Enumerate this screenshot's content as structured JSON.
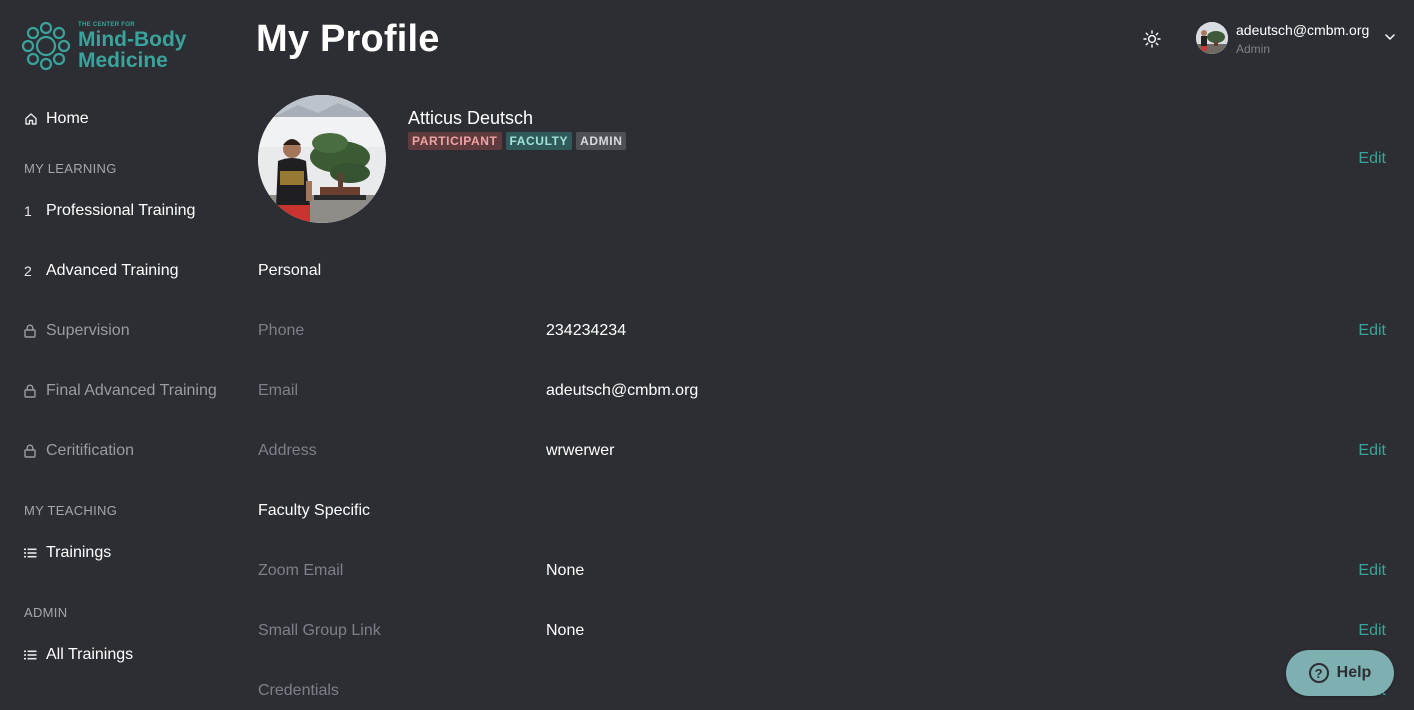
{
  "logo": {
    "small_text": "THE CENTER FOR",
    "line1": "Mind-Body",
    "line2": "Medicine",
    "brand_color": "#3aa39b"
  },
  "header": {
    "title": "My Profile",
    "theme_icon": "sun-icon"
  },
  "user_menu": {
    "email": "adeutsch@cmbm.org",
    "role": "Admin",
    "chevron_icon": "chevron-down-icon"
  },
  "sidebar": {
    "home": {
      "label": "Home",
      "icon": "home-icon"
    },
    "my_learning_label": "MY LEARNING",
    "learning_items": [
      {
        "marker": "1",
        "label": "Professional Training",
        "locked": false
      },
      {
        "marker": "2",
        "label": "Advanced Training",
        "locked": false
      },
      {
        "marker": "lock-icon",
        "label": "Supervision",
        "locked": true
      },
      {
        "marker": "lock-icon",
        "label": "Final Advanced Training",
        "locked": true
      },
      {
        "marker": "lock-icon",
        "label": "Ceritification",
        "locked": true
      }
    ],
    "my_teaching_label": "MY TEACHING",
    "teaching_items": [
      {
        "icon": "list-icon",
        "label": "Trainings"
      }
    ],
    "admin_label": "ADMIN",
    "admin_items": [
      {
        "icon": "list-icon",
        "label": "All Trainings"
      }
    ]
  },
  "profile": {
    "name": "Atticus Deutsch",
    "badges": [
      "PARTICIPANT",
      "FACULTY",
      "ADMIN"
    ],
    "edit_label": "Edit"
  },
  "personal": {
    "title": "Personal",
    "fields": [
      {
        "label": "Phone",
        "value": "234234234",
        "edit": "Edit"
      },
      {
        "label": "Email",
        "value": "adeutsch@cmbm.org",
        "edit": ""
      },
      {
        "label": "Address",
        "value": "wrwerwer",
        "edit": "Edit"
      }
    ]
  },
  "faculty": {
    "title": "Faculty Specific",
    "fields": [
      {
        "label": "Zoom Email",
        "value": "None",
        "edit": "Edit"
      },
      {
        "label": "Small Group Link",
        "value": "None",
        "edit": "Edit"
      },
      {
        "label": "Credentials",
        "value": "",
        "edit": "Edit"
      }
    ]
  },
  "help": {
    "label": "Help",
    "icon": "question-circle-icon"
  },
  "colors": {
    "background": "#2d2e33",
    "accent": "#3aa39b",
    "muted_text": "#7d8088",
    "help_button": "#7fb0b1"
  }
}
